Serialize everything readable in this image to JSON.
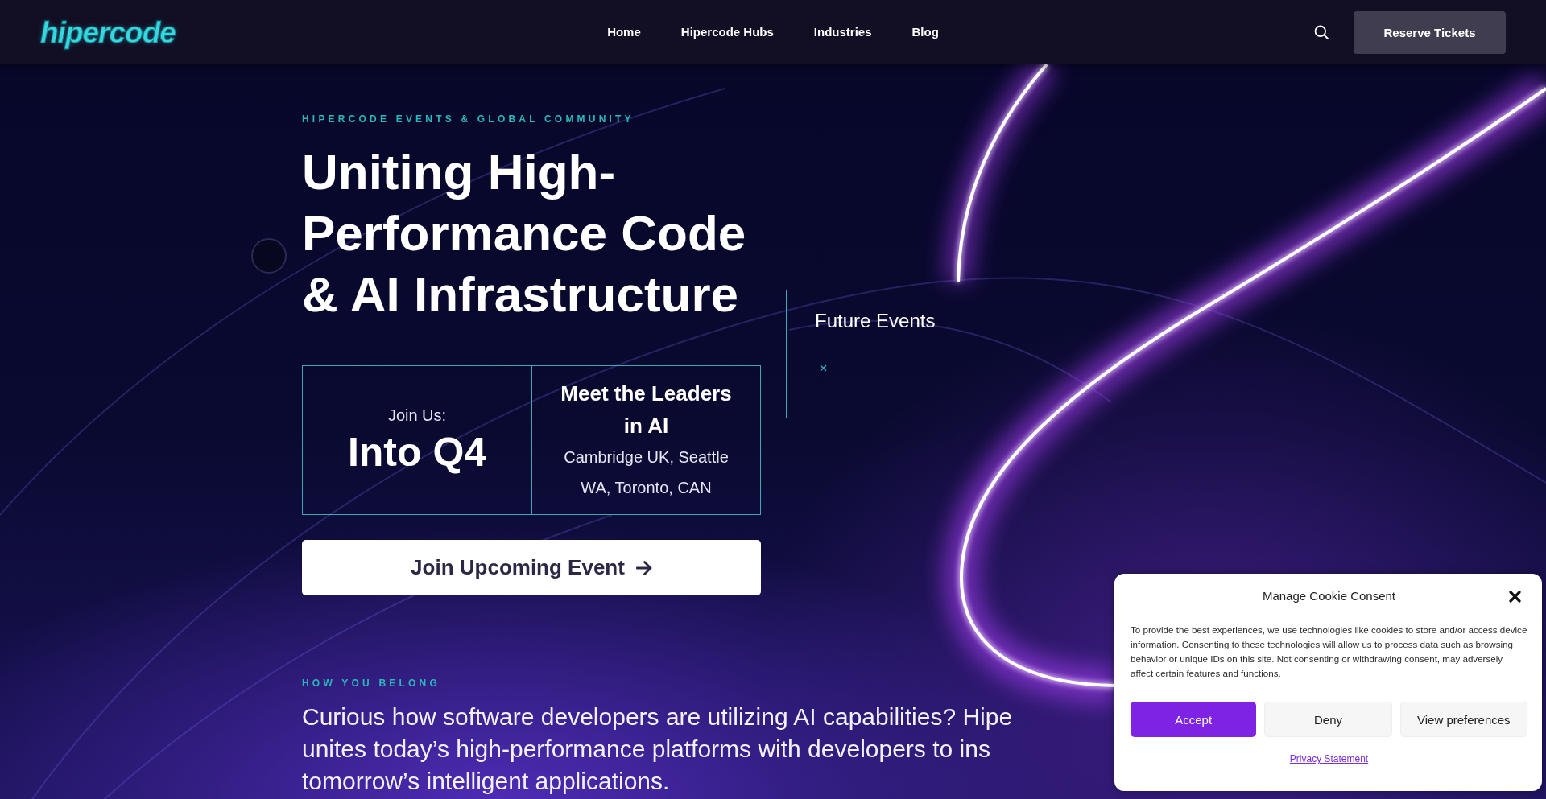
{
  "header": {
    "logo": "hipercode",
    "nav": [
      {
        "label": "Home"
      },
      {
        "label": "Hipercode Hubs"
      },
      {
        "label": "Industries"
      },
      {
        "label": "Blog"
      }
    ],
    "cta": "Reserve Tickets"
  },
  "hero": {
    "eyebrow": "HIPERCODE EVENTS & GLOBAL COMMUNITY",
    "title_lines": [
      "Uniting High-",
      "Performance Code",
      "& AI Infrastructure"
    ],
    "highlights": [
      {
        "kind": "date",
        "label": "Join Us:",
        "value": "Into Q4"
      },
      {
        "kind": "locations",
        "title": "Meet the Leaders in AI",
        "text": "Cambridge UK, Seattle WA, Toronto, CAN"
      }
    ],
    "cta": "Join Upcoming Event",
    "events_panel": {
      "title": "Future Events"
    }
  },
  "belong": {
    "eyebrow": "HOW YOU BELONG",
    "lines": [
      "Curious how software developers are utilizing AI capabilities? Hipe",
      "unites today’s high-performance platforms with developers to ins",
      "tomorrow’s intelligent applications."
    ]
  },
  "cookie_dialog": {
    "title": "Manage Cookie Consent",
    "text": "To provide the best experiences, we use technologies like cookies to store and/or access device information. Consenting to these technologies will allow us to process data such as browsing behavior or unique IDs on this site. Not consenting or withdrawing consent, may adversely affect certain features and functions.",
    "buttons": [
      {
        "label": "Accept",
        "kind": "primary"
      },
      {
        "label": "Deny",
        "kind": "secondary"
      },
      {
        "label": "View preferences",
        "kind": "secondary"
      }
    ],
    "link": "Privacy Statement"
  }
}
